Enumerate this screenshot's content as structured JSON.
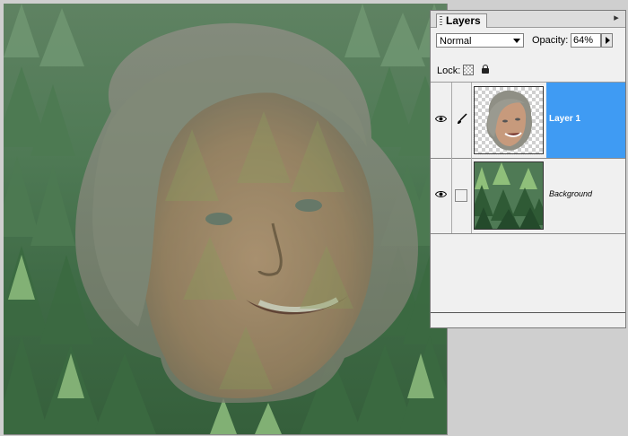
{
  "palette": {
    "tab_label": "Layers",
    "blend_mode": "Normal",
    "opacity_label": "Opacity:",
    "opacity_value": "64%",
    "lock_label": "Lock:",
    "layers": [
      {
        "name": "Layer 1",
        "visible": true,
        "selected": true,
        "icon": "brush-icon"
      },
      {
        "name": "Background",
        "visible": true,
        "selected": false,
        "icon": "none"
      }
    ]
  },
  "colors": {
    "selection_blue": "#3f9bf3",
    "palette_bg": "#f0f0f0",
    "forest_green": "#4f7a55"
  }
}
